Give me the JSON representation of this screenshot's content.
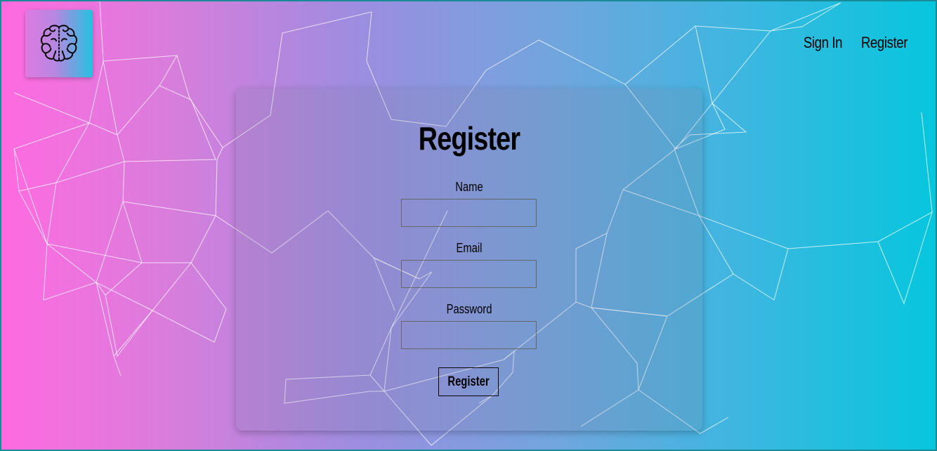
{
  "nav": {
    "signin_label": "Sign In",
    "register_label": "Register"
  },
  "form": {
    "title": "Register",
    "name_label": "Name",
    "name_value": "",
    "email_label": "Email",
    "email_value": "",
    "password_label": "Password",
    "password_value": "",
    "submit_label": "Register"
  },
  "icons": {
    "logo": "brain-icon"
  },
  "colors": {
    "gradient_left": "#ff6ae0",
    "gradient_right": "#06c6dd",
    "text": "#000000"
  }
}
